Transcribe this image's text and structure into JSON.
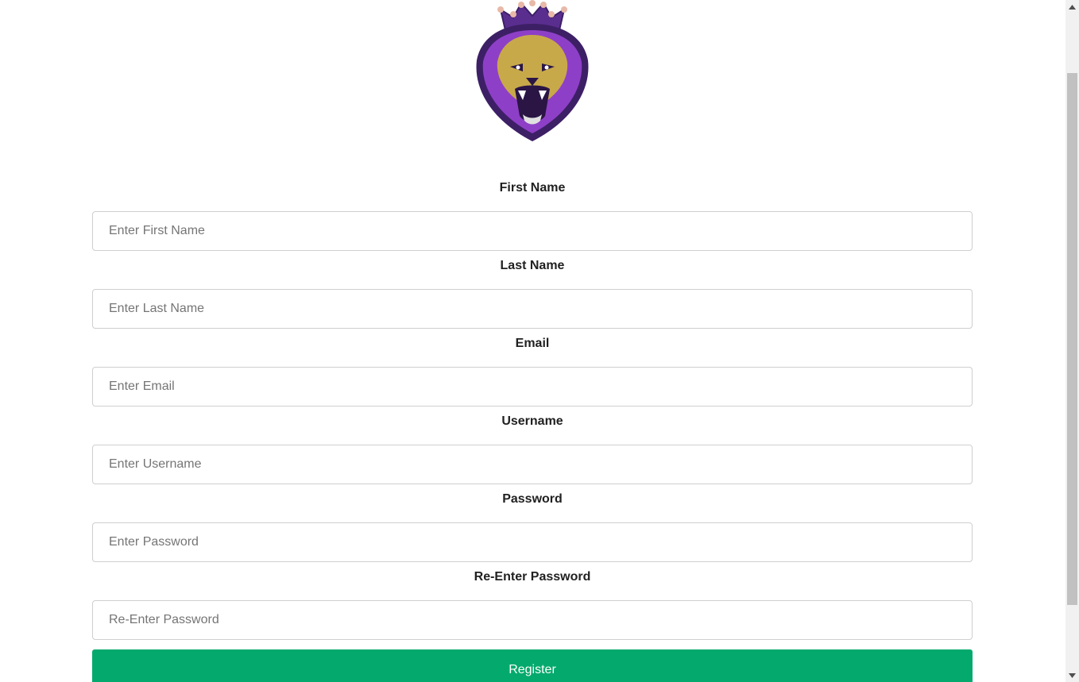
{
  "logo": {
    "icon": "lion-crown-logo-icon",
    "colors": {
      "purple": "#8e3fc7",
      "dark_purple": "#4a2a7a",
      "gold": "#c8a94a",
      "crown_pink": "#e8b9a8"
    }
  },
  "form": {
    "fields": [
      {
        "label": "First Name",
        "placeholder": "Enter First Name"
      },
      {
        "label": "Last Name",
        "placeholder": "Enter Last Name"
      },
      {
        "label": "Email",
        "placeholder": "Enter Email"
      },
      {
        "label": "Username",
        "placeholder": "Enter Username"
      },
      {
        "label": "Password",
        "placeholder": "Enter Password"
      },
      {
        "label": "Re-Enter Password",
        "placeholder": "Re-Enter Password"
      }
    ],
    "register_label": "Register",
    "register_color": "#04aa6d"
  },
  "scrollbar": {
    "up_icon": "scroll-up-arrow-icon",
    "down_icon": "scroll-down-arrow-icon"
  }
}
